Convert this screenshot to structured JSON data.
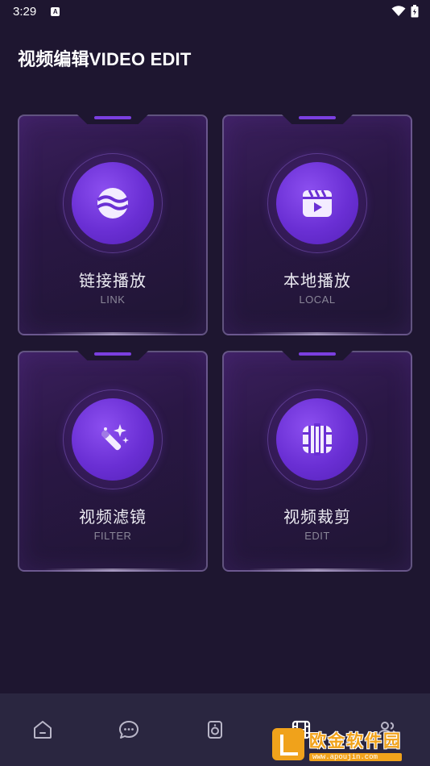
{
  "status_bar": {
    "time": "3:29",
    "notification_icon": "A"
  },
  "header": {
    "title": "视频编辑VIDEO EDIT"
  },
  "cards": [
    {
      "label": "链接播放",
      "sub": "LINK",
      "icon": "wave-ball-icon"
    },
    {
      "label": "本地播放",
      "sub": "LOCAL",
      "icon": "clapperboard-icon"
    },
    {
      "label": "视频滤镜",
      "sub": "FILTER",
      "icon": "magic-wand-icon"
    },
    {
      "label": "视频裁剪",
      "sub": "EDIT",
      "icon": "film-crop-icon"
    }
  ],
  "bottom_nav": [
    {
      "icon": "home-icon",
      "active": false
    },
    {
      "icon": "chat-icon",
      "active": false
    },
    {
      "icon": "speaker-icon",
      "active": false
    },
    {
      "icon": "film-icon",
      "active": true
    },
    {
      "icon": "users-icon",
      "active": false
    }
  ],
  "watermark": {
    "title": "欧金软件园",
    "url": "www.apoujin.com"
  },
  "colors": {
    "background": "#1e1630",
    "accent": "#6a2fd4",
    "nav": "#2a2640"
  }
}
